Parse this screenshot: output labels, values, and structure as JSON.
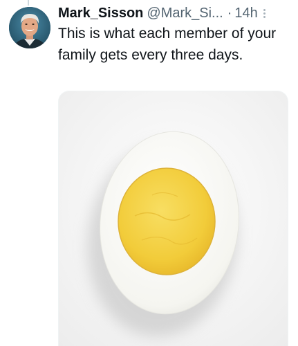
{
  "tweet": {
    "author_name": "Mark_Sisson",
    "author_handle": "@Mark_Si...",
    "separator": "·",
    "timestamp": "14h",
    "text": "This is what each member of your family gets every three days."
  },
  "icons": {
    "avatar": "author-avatar-photo",
    "more": "more-options-icon"
  },
  "media": {
    "subject": "halved hard-boiled egg"
  },
  "colors": {
    "primary_text": "#0f1419",
    "secondary_text": "#536471",
    "egg_yolk": "#f2cc3a",
    "egg_white": "#fbfbf8"
  }
}
